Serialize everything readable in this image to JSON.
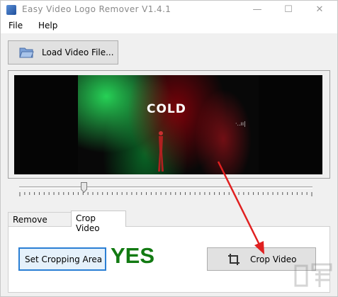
{
  "window": {
    "title": "Easy Video Logo Remover V1.4.1",
    "controls": {
      "minimize": "—",
      "maximize": "☐",
      "close": "✕"
    }
  },
  "menu": {
    "file": "File",
    "help": "Help"
  },
  "toolbar": {
    "load_label": "Load Video File..."
  },
  "video": {
    "overlay_title": "COLD",
    "overlay_caption": "·..ıı|"
  },
  "slider": {
    "position_fraction": 0.22
  },
  "tabs": {
    "items": [
      {
        "label": "Remove Logo",
        "active": false
      },
      {
        "label": "Crop Video",
        "active": true
      }
    ]
  },
  "crop_panel": {
    "set_area_label": "Set Cropping Area",
    "status_label": "YES",
    "crop_label": "Crop Video"
  },
  "colors": {
    "accent_focus": "#2a7fd4",
    "status_green": "#127a12",
    "annotation_arrow": "#e02020"
  }
}
